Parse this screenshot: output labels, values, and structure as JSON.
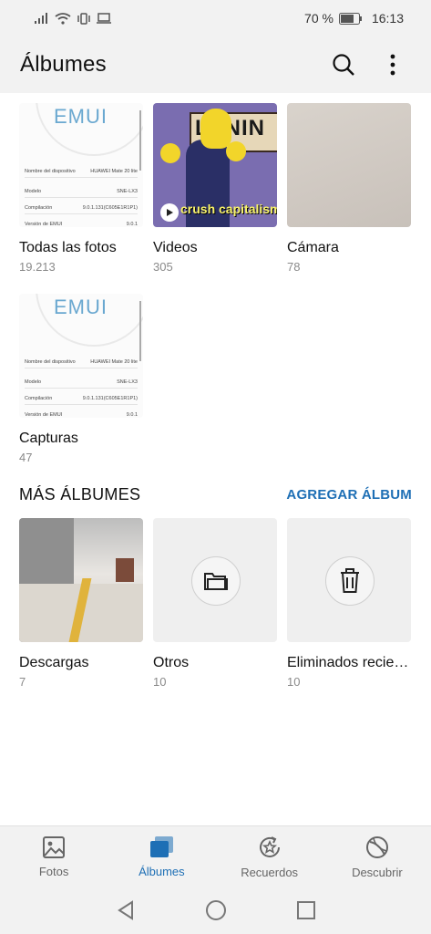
{
  "status": {
    "battery": "70 %",
    "time": "16:13"
  },
  "header": {
    "title": "Álbumes"
  },
  "albums": [
    {
      "name": "Todas las fotos",
      "count": "19.213"
    },
    {
      "name": "Videos",
      "count": "305"
    },
    {
      "name": "Cámara",
      "count": "78"
    },
    {
      "name": "Capturas",
      "count": "47"
    }
  ],
  "shot": {
    "logo": "EMUI",
    "rows": [
      {
        "label": "Nombre del dispositivo",
        "value": "HUAWEI Mate 20 lite"
      },
      {
        "label": "Modelo",
        "value": "SNE-LX3"
      },
      {
        "label": "Compilación",
        "value": "9.0.1.131(C605E1R1P1)"
      },
      {
        "label": "Versión de EMUI",
        "value": "9.0.1"
      }
    ]
  },
  "video_thumb": {
    "sign": "LENIN",
    "caption": "crush capitalism"
  },
  "more": {
    "title": "MÁS ÁLBUMES",
    "action": "AGREGAR ÁLBUM"
  },
  "more_albums": [
    {
      "name": "Descargas",
      "count": "7"
    },
    {
      "name": "Otros",
      "count": "10"
    },
    {
      "name": "Eliminados recie…",
      "count": "10"
    }
  ],
  "nav": [
    {
      "label": "Fotos",
      "icon": "photo-icon"
    },
    {
      "label": "Álbumes",
      "icon": "albums-icon"
    },
    {
      "label": "Recuerdos",
      "icon": "memories-icon"
    },
    {
      "label": "Descubrir",
      "icon": "discover-icon"
    }
  ],
  "colors": {
    "accent": "#1e6fb5",
    "bar": "#f2f2f2"
  }
}
